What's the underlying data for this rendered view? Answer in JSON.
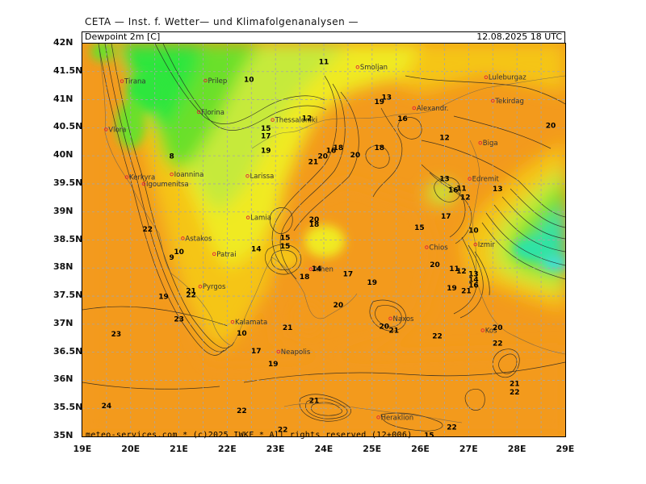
{
  "header": "CETA — Inst. f. Wetter— und Klimafolgenanalysen —",
  "variable_label": "Dewpoint 2m [C]",
  "datetime": "12.08.2025 18 UTC",
  "footer": "meteo-services.com * (c)2025 IWKF * All rights reserved (12+006)",
  "lat_ticks": [
    "42N",
    "41.5N",
    "41N",
    "40.5N",
    "40N",
    "39.5N",
    "39N",
    "38.5N",
    "38N",
    "37.5N",
    "37N",
    "36.5N",
    "36N",
    "35.5N",
    "35N"
  ],
  "lon_ticks": [
    "19E",
    "20E",
    "21E",
    "22E",
    "23E",
    "24E",
    "25E",
    "26E",
    "27E",
    "28E",
    "29E"
  ],
  "colors": {
    "orange": "#f39a1c",
    "yellow_orange": "#f5c518",
    "yellow": "#f0ea24",
    "yellow_green": "#c6ea3a",
    "green": "#6ae02a",
    "bright_green": "#2ee63c",
    "teal": "#2fe3a6",
    "cyan": "#3bdedc",
    "grid": "#a6a6a6"
  },
  "cities": [
    {
      "name": "Tirana",
      "lat": 41.33,
      "lon": 19.82
    },
    {
      "name": "Prilep",
      "lat": 41.34,
      "lon": 21.55
    },
    {
      "name": "Smoljan",
      "lat": 41.58,
      "lon": 24.7
    },
    {
      "name": "Luleburgaz",
      "lat": 41.4,
      "lon": 27.36
    },
    {
      "name": "Tekirdag",
      "lat": 40.98,
      "lon": 27.5
    },
    {
      "name": "Florina",
      "lat": 40.78,
      "lon": 21.41
    },
    {
      "name": "Thessaloniki",
      "lat": 40.64,
      "lon": 22.94
    },
    {
      "name": "Alexandr.",
      "lat": 40.85,
      "lon": 25.87
    },
    {
      "name": "Vlora",
      "lat": 40.47,
      "lon": 19.49
    },
    {
      "name": "Biga",
      "lat": 40.23,
      "lon": 27.24
    },
    {
      "name": "Kerkyra",
      "lat": 39.62,
      "lon": 19.92
    },
    {
      "name": "Ioannina",
      "lat": 39.67,
      "lon": 20.85
    },
    {
      "name": "Larissa",
      "lat": 39.64,
      "lon": 22.42
    },
    {
      "name": "Edremit",
      "lat": 39.59,
      "lon": 27.02
    },
    {
      "name": "Igoumenitsa",
      "lat": 39.5,
      "lon": 20.27
    },
    {
      "name": "Lamia",
      "lat": 38.9,
      "lon": 22.43
    },
    {
      "name": "Astakos",
      "lat": 38.53,
      "lon": 21.08
    },
    {
      "name": "Patrai",
      "lat": 38.25,
      "lon": 21.73
    },
    {
      "name": "Chios",
      "lat": 38.37,
      "lon": 26.13
    },
    {
      "name": "Izmir",
      "lat": 38.42,
      "lon": 27.14
    },
    {
      "name": "Athen",
      "lat": 37.98,
      "lon": 23.73
    },
    {
      "name": "Pyrgos",
      "lat": 37.67,
      "lon": 21.44
    },
    {
      "name": "Naxos",
      "lat": 37.1,
      "lon": 25.38
    },
    {
      "name": "Kos",
      "lat": 36.89,
      "lon": 27.29
    },
    {
      "name": "Kalamata",
      "lat": 37.04,
      "lon": 22.11
    },
    {
      "name": "Neapolis",
      "lat": 36.51,
      "lon": 23.06
    },
    {
      "name": "Heraklion",
      "lat": 35.34,
      "lon": 25.13
    }
  ],
  "contour_labels": [
    {
      "text": "11",
      "lat": 41.63,
      "lon": 24.0
    },
    {
      "text": "10",
      "lat": 41.32,
      "lon": 22.45
    },
    {
      "text": "12",
      "lat": 40.63,
      "lon": 23.65
    },
    {
      "text": "13",
      "lat": 41.0,
      "lon": 25.3
    },
    {
      "text": "19",
      "lat": 40.92,
      "lon": 25.15
    },
    {
      "text": "16",
      "lat": 40.62,
      "lon": 25.63
    },
    {
      "text": "15",
      "lat": 40.45,
      "lon": 22.8
    },
    {
      "text": "17",
      "lat": 40.31,
      "lon": 22.8
    },
    {
      "text": "19",
      "lat": 40.05,
      "lon": 22.8
    },
    {
      "text": "16",
      "lat": 40.05,
      "lon": 24.15
    },
    {
      "text": "18",
      "lat": 40.1,
      "lon": 24.3
    },
    {
      "text": "20",
      "lat": 39.95,
      "lon": 23.98
    },
    {
      "text": "20",
      "lat": 39.97,
      "lon": 24.65
    },
    {
      "text": "18",
      "lat": 40.1,
      "lon": 25.15
    },
    {
      "text": "12",
      "lat": 40.28,
      "lon": 26.5
    },
    {
      "text": "20",
      "lat": 40.5,
      "lon": 28.7
    },
    {
      "text": "21",
      "lat": 39.85,
      "lon": 23.78
    },
    {
      "text": "8",
      "lat": 39.95,
      "lon": 20.85
    },
    {
      "text": "13",
      "lat": 39.55,
      "lon": 26.5
    },
    {
      "text": "13",
      "lat": 39.37,
      "lon": 27.6
    },
    {
      "text": "11",
      "lat": 39.38,
      "lon": 26.85
    },
    {
      "text": "16",
      "lat": 39.35,
      "lon": 26.68
    },
    {
      "text": "12",
      "lat": 39.22,
      "lon": 26.93
    },
    {
      "text": "20",
      "lat": 38.82,
      "lon": 23.8
    },
    {
      "text": "18",
      "lat": 38.74,
      "lon": 23.8
    },
    {
      "text": "17",
      "lat": 38.88,
      "lon": 26.53
    },
    {
      "text": "15",
      "lat": 38.68,
      "lon": 25.98
    },
    {
      "text": "10",
      "lat": 38.63,
      "lon": 27.1
    },
    {
      "text": "22",
      "lat": 38.65,
      "lon": 20.35
    },
    {
      "text": "15",
      "lat": 38.5,
      "lon": 23.2
    },
    {
      "text": "15",
      "lat": 38.35,
      "lon": 23.2
    },
    {
      "text": "14",
      "lat": 38.3,
      "lon": 22.6
    },
    {
      "text": "10",
      "lat": 38.25,
      "lon": 21.0
    },
    {
      "text": "9",
      "lat": 38.15,
      "lon": 20.85
    },
    {
      "text": "20",
      "lat": 38.02,
      "lon": 26.3
    },
    {
      "text": "11",
      "lat": 37.95,
      "lon": 26.7
    },
    {
      "text": "12",
      "lat": 37.9,
      "lon": 26.85
    },
    {
      "text": "14",
      "lat": 37.95,
      "lon": 23.85
    },
    {
      "text": "17",
      "lat": 37.85,
      "lon": 24.5
    },
    {
      "text": "18",
      "lat": 37.8,
      "lon": 23.6
    },
    {
      "text": "19",
      "lat": 37.7,
      "lon": 25.0
    },
    {
      "text": "13",
      "lat": 37.85,
      "lon": 27.1
    },
    {
      "text": "14",
      "lat": 37.75,
      "lon": 27.1
    },
    {
      "text": "16",
      "lat": 37.65,
      "lon": 27.1
    },
    {
      "text": "19",
      "lat": 37.6,
      "lon": 26.65
    },
    {
      "text": "21",
      "lat": 37.55,
      "lon": 26.95
    },
    {
      "text": "21",
      "lat": 37.55,
      "lon": 21.25
    },
    {
      "text": "22",
      "lat": 37.48,
      "lon": 21.25
    },
    {
      "text": "19",
      "lat": 37.45,
      "lon": 20.68
    },
    {
      "text": "20",
      "lat": 37.3,
      "lon": 24.3
    },
    {
      "text": "23",
      "lat": 37.05,
      "lon": 21.0
    },
    {
      "text": "20",
      "lat": 36.92,
      "lon": 25.25
    },
    {
      "text": "21",
      "lat": 36.85,
      "lon": 25.45
    },
    {
      "text": "21",
      "lat": 36.9,
      "lon": 23.25
    },
    {
      "text": "20",
      "lat": 36.9,
      "lon": 27.6
    },
    {
      "text": "22",
      "lat": 36.75,
      "lon": 26.35
    },
    {
      "text": "22",
      "lat": 36.62,
      "lon": 27.6
    },
    {
      "text": "23",
      "lat": 36.78,
      "lon": 19.7
    },
    {
      "text": "10",
      "lat": 36.8,
      "lon": 22.3
    },
    {
      "text": "17",
      "lat": 36.48,
      "lon": 22.6
    },
    {
      "text": "19",
      "lat": 36.25,
      "lon": 22.95
    },
    {
      "text": "21",
      "lat": 35.9,
      "lon": 27.95
    },
    {
      "text": "22",
      "lat": 35.75,
      "lon": 27.95
    },
    {
      "text": "24",
      "lat": 35.5,
      "lon": 19.5
    },
    {
      "text": "22",
      "lat": 35.42,
      "lon": 22.3
    },
    {
      "text": "21",
      "lat": 35.6,
      "lon": 23.8
    },
    {
      "text": "22",
      "lat": 35.08,
      "lon": 23.15
    },
    {
      "text": "22",
      "lat": 35.12,
      "lon": 26.65
    },
    {
      "text": "15",
      "lat": 34.98,
      "lon": 26.18
    }
  ]
}
